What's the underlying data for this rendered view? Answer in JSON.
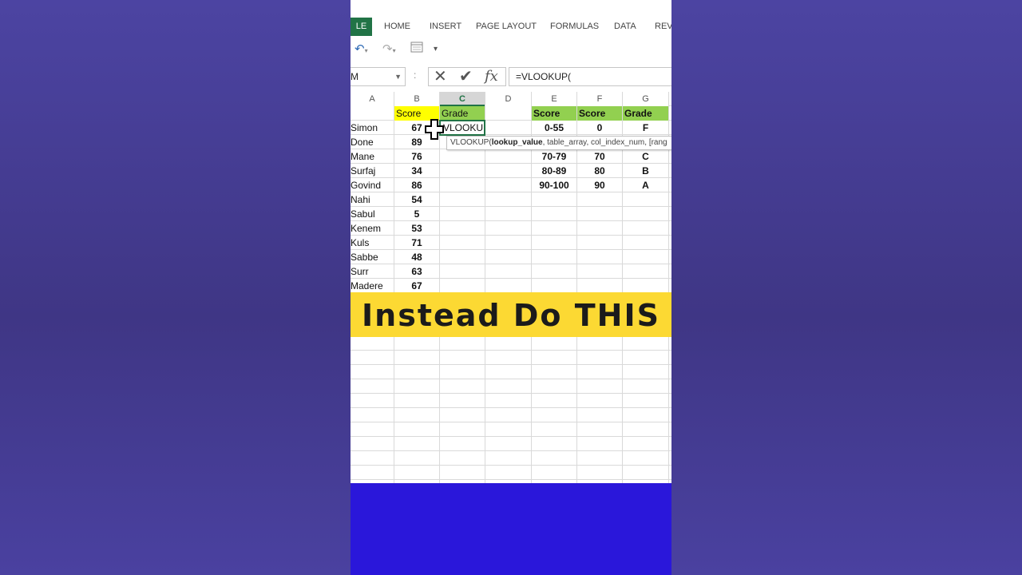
{
  "ribbon": {
    "file_tab": "LE",
    "tabs": [
      "HOME",
      "INSERT",
      "PAGE LAYOUT",
      "FORMULAS",
      "DATA",
      "REVI"
    ]
  },
  "formula_bar": {
    "name_box": "M",
    "separator": ":",
    "formula": "=VLOOKUP("
  },
  "columns": [
    "A",
    "B",
    "C",
    "D",
    "E",
    "F",
    "G"
  ],
  "active_column": "C",
  "sheet": {
    "header_row": {
      "score": "Score",
      "grade": "Grade"
    },
    "rows": [
      {
        "name": "Simon",
        "score": "67"
      },
      {
        "name": "Done",
        "score": "89"
      },
      {
        "name": "Mane",
        "score": "76"
      },
      {
        "name": "Surfaj",
        "score": "34"
      },
      {
        "name": "Govind",
        "score": "86"
      },
      {
        "name": "Nahi",
        "score": "54"
      },
      {
        "name": "Sabul",
        "score": "5"
      },
      {
        "name": "Kenem",
        "score": "53"
      },
      {
        "name": "Kuls",
        "score": "71"
      },
      {
        "name": "Sabbe",
        "score": "48"
      },
      {
        "name": "Surr",
        "score": "63"
      },
      {
        "name": "Madere",
        "score": "67"
      }
    ],
    "editing_cell": "VLOOKUP(",
    "lookup_table": {
      "headers": [
        "Score",
        "Score",
        "Grade"
      ],
      "rows": [
        [
          "0-55",
          "0",
          "F"
        ],
        [
          "",
          "",
          ""
        ],
        [
          "70-79",
          "70",
          "C"
        ],
        [
          "80-89",
          "80",
          "B"
        ],
        [
          "90-100",
          "90",
          "A"
        ]
      ]
    }
  },
  "tooltip": {
    "func": "VLOOKUP(",
    "bold_arg": "lookup_value",
    "rest": ", table_array, col_index_num, [rang"
  },
  "banner": {
    "text": "Instead Do THIS",
    "color": "#fcd933"
  },
  "colors": {
    "excel_green": "#217346",
    "header_yellow": "#ffff00",
    "table_green": "#92d050",
    "bottom_blue": "#2a17da"
  }
}
